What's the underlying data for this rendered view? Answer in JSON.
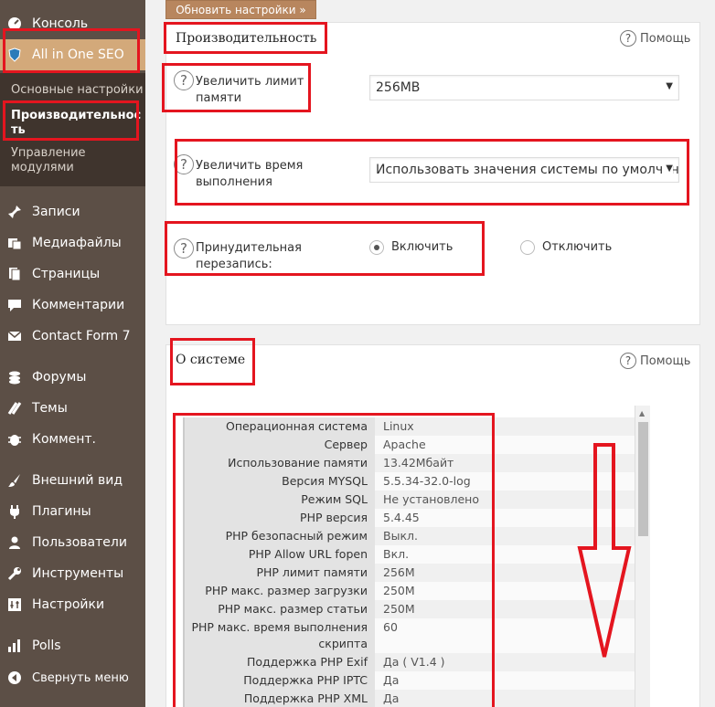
{
  "top_button": "Обновить настройки »",
  "sidebar": {
    "items": [
      {
        "label": "Консоль",
        "icon": "dashboard-icon"
      },
      {
        "label": "All in One SEO",
        "icon": "aioseo-shield-icon"
      },
      {
        "label": "Записи",
        "icon": "pin-icon"
      },
      {
        "label": "Медиафайлы",
        "icon": "media-icon"
      },
      {
        "label": "Страницы",
        "icon": "pages-icon"
      },
      {
        "label": "Комментарии",
        "icon": "comment-icon"
      },
      {
        "label": "Contact Form 7",
        "icon": "mail-icon"
      },
      {
        "label": "Форумы",
        "icon": "forums-icon"
      },
      {
        "label": "Темы",
        "icon": "topics-icon"
      },
      {
        "label": "Коммент.",
        "icon": "bug-icon"
      },
      {
        "label": "Внешний вид",
        "icon": "brush-icon"
      },
      {
        "label": "Плагины",
        "icon": "plugin-icon"
      },
      {
        "label": "Пользователи",
        "icon": "user-icon"
      },
      {
        "label": "Инструменты",
        "icon": "wrench-icon"
      },
      {
        "label": "Настройки",
        "icon": "settings-icon"
      },
      {
        "label": "Polls",
        "icon": "polls-icon"
      },
      {
        "label": "Свернуть меню",
        "icon": "collapse-icon"
      }
    ],
    "submenu": [
      {
        "label": "Основные настройки"
      },
      {
        "label": "Производительнос\nть"
      },
      {
        "label": "Управление\nмодулями"
      }
    ]
  },
  "performance": {
    "title": "Производительность",
    "help": "Помощь",
    "memory_label": "Увеличить лимит\nпамяти",
    "memory_value": "256MB",
    "time_label": "Увеличить время\nвыполнения",
    "time_value": "Использовать значения системы по умолчан",
    "rewrite_label": "Принудительная\nперезапись:",
    "rewrite_on": "Включить",
    "rewrite_off": "Отключить"
  },
  "system": {
    "title": "О системе",
    "help": "Помощь",
    "rows": [
      {
        "k": "Операционная система",
        "v": "Linux"
      },
      {
        "k": "Сервер",
        "v": "Apache"
      },
      {
        "k": "Использование памяти",
        "v": "13.42Мбайт"
      },
      {
        "k": "Версия MYSQL",
        "v": "5.5.34-32.0-log"
      },
      {
        "k": "Режим SQL",
        "v": "Не установлено"
      },
      {
        "k": "PHP версия",
        "v": "5.4.45"
      },
      {
        "k": "PHP безопасный режим",
        "v": "Выкл."
      },
      {
        "k": "PHP Allow URL fopen",
        "v": "Вкл."
      },
      {
        "k": "PHP лимит памяти",
        "v": "256M"
      },
      {
        "k": "PHP макс. размер загрузки",
        "v": "250M"
      },
      {
        "k": "PHP макс. размер статьи",
        "v": "250M"
      },
      {
        "k": "PHP макс. время выполнения скрипта",
        "v": "60"
      },
      {
        "k": "Поддержка PHP Exif",
        "v": "Да ( V1.4 )"
      },
      {
        "k": "Поддержка PHP IPTC",
        "v": "Да"
      },
      {
        "k": "Поддержка PHP XML",
        "v": "Да"
      }
    ]
  },
  "colors": {
    "sidebar_bg": "#5c4f46",
    "submenu_bg": "#3f342d",
    "active_item": "#d3a97a",
    "button": "#b8865e",
    "annotation_red": "#e4151f"
  }
}
